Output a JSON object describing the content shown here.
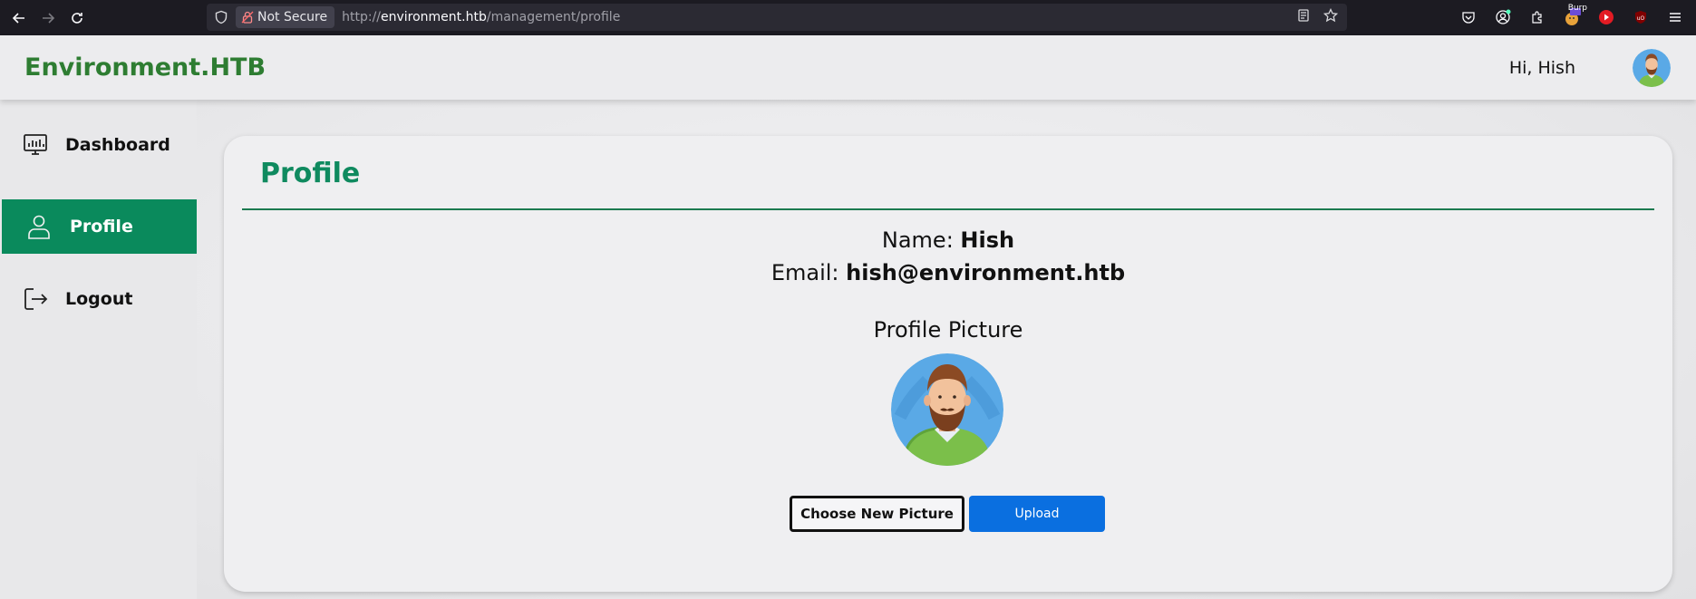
{
  "browser": {
    "security_label": "Not Secure",
    "url_scheme": "http://",
    "url_host": "environment.htb",
    "url_path": "/management/profile",
    "extension_badge": "Burp"
  },
  "header": {
    "brand": "Environment.HTB",
    "greeting": "Hi, Hish"
  },
  "sidebar": {
    "items": [
      {
        "label": "Dashboard",
        "icon": "dashboard-monitor-icon",
        "active": false
      },
      {
        "label": "Profile",
        "icon": "user-icon",
        "active": true
      },
      {
        "label": "Logout",
        "icon": "logout-icon",
        "active": false
      }
    ]
  },
  "profile": {
    "title": "Profile",
    "name_label": "Name:",
    "name_value": "Hish",
    "email_label": "Email:",
    "email_value": "hish@environment.htb",
    "picture_label": "Profile Picture",
    "choose_button": "Choose New Picture",
    "upload_button": "Upload"
  },
  "colors": {
    "brand": "#2e7d32",
    "accent": "#0a8a5c",
    "upload": "#0a6fe0"
  }
}
